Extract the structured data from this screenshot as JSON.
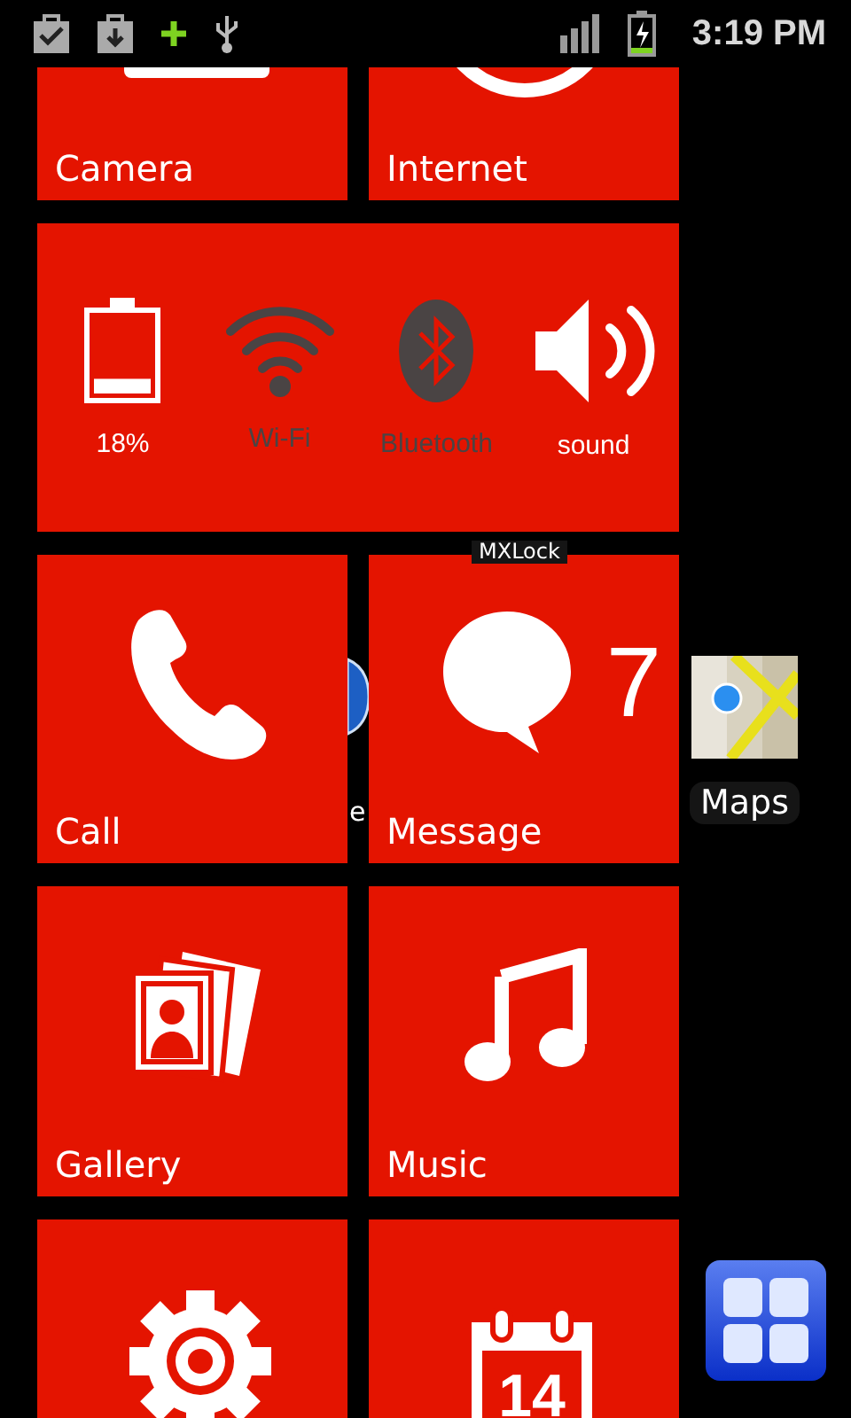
{
  "status_bar": {
    "time": "3:19 PM"
  },
  "home_shortcuts": [
    {
      "kind": "label",
      "label": "MXLock"
    },
    {
      "kind": "browser",
      "label": "e"
    },
    {
      "kind": "maps",
      "label": "Maps"
    },
    {
      "kind": "drawer"
    }
  ],
  "tiles": [
    {
      "kind": "camera",
      "label": "Camera"
    },
    {
      "kind": "internet",
      "label": "Internet"
    },
    {
      "kind": "toggles",
      "toggles": [
        {
          "kind": "battery",
          "label": "18%",
          "on": true,
          "level": 0.18
        },
        {
          "kind": "wifi",
          "label": "Wi-Fi",
          "on": false
        },
        {
          "kind": "bluetooth",
          "label": "Bluetooth",
          "on": false
        },
        {
          "kind": "sound",
          "label": "sound",
          "on": true
        }
      ]
    },
    {
      "kind": "call",
      "label": "Call"
    },
    {
      "kind": "message",
      "label": "Message",
      "count": "7"
    },
    {
      "kind": "gallery",
      "label": "Gallery"
    },
    {
      "kind": "music",
      "label": "Music"
    },
    {
      "kind": "settings"
    },
    {
      "kind": "calendar",
      "date": "14"
    }
  ]
}
